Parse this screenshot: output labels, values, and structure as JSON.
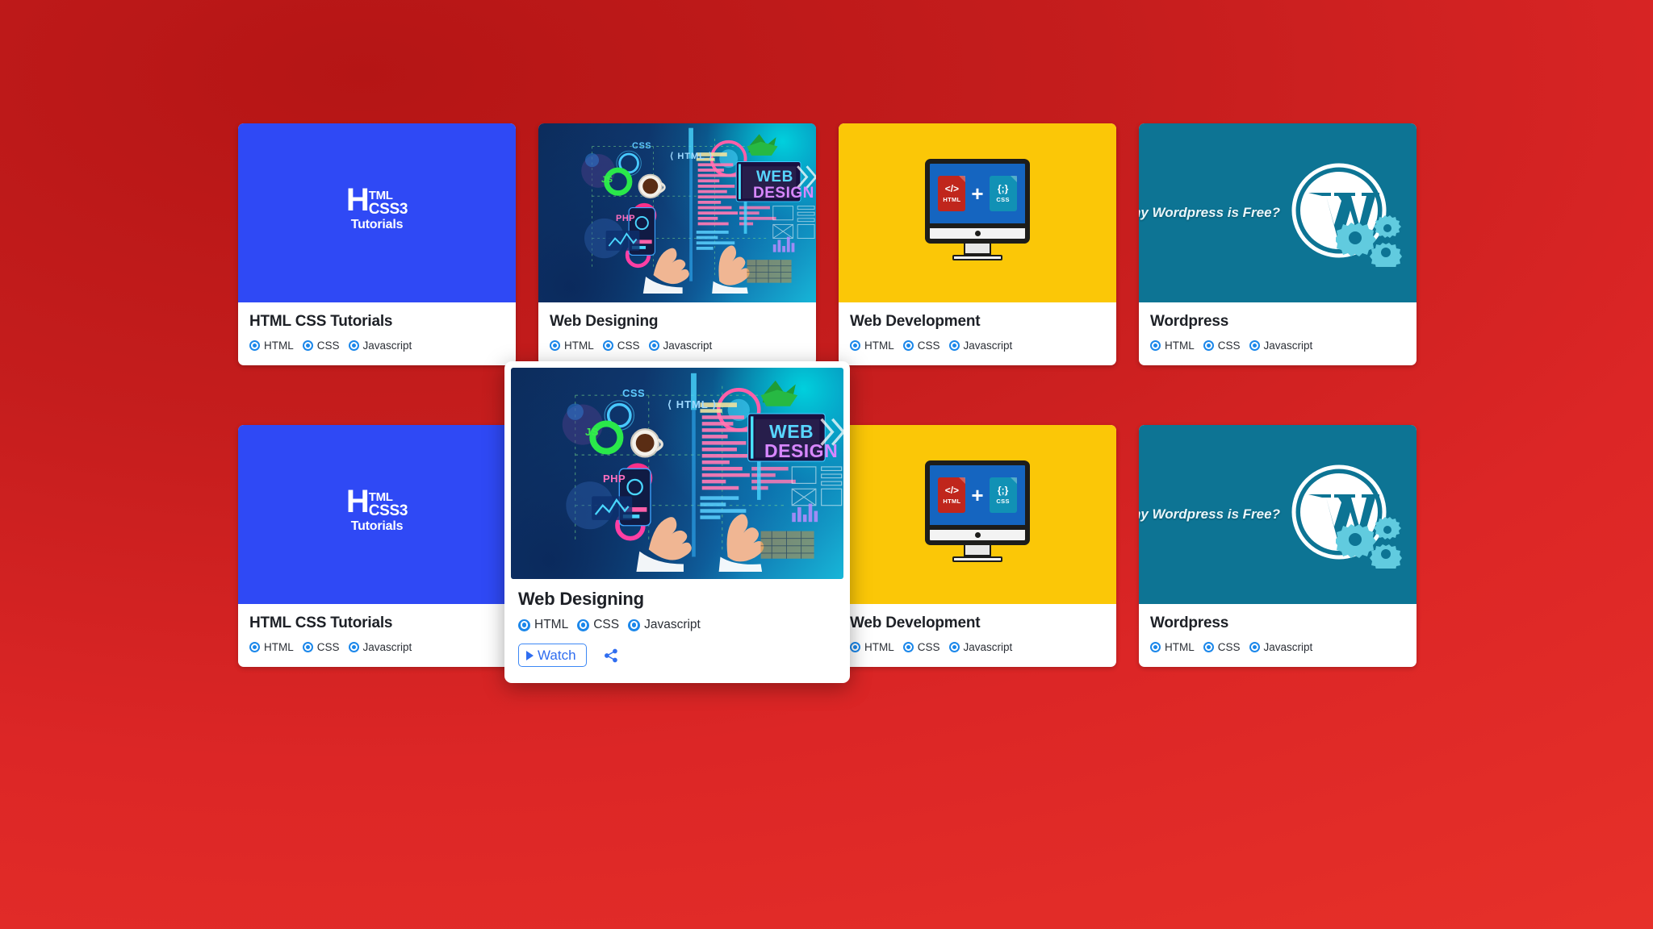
{
  "page": {
    "background_color": "#d91f1f",
    "background_accent": "#b51515"
  },
  "theme": {
    "accent_blue": "#1b87ea",
    "watch_blue": "#2f6df0",
    "card_bg": "#ffffff",
    "title_color": "#1d2026"
  },
  "tags": {
    "html": "HTML",
    "css": "CSS",
    "javascript": "Javascript"
  },
  "thumbs": {
    "htmlcss_logo": {
      "h": "H",
      "tml": "TML",
      "css3": "CSS3",
      "tutorials": "Tutorials"
    },
    "webdesign_labels": {
      "css": "CSS",
      "js": "JS",
      "php": "PHP",
      "html": "HTML",
      "web": "WEB",
      "design": "DESIGN"
    },
    "webdev_monitor": {
      "html_code": "</>",
      "html_label": "HTML",
      "css_code": "{;}",
      "css_label": "CSS",
      "plus": "+"
    },
    "wordpress_caption": "hy Wordpress is Free?",
    "wordpress_mark": "W"
  },
  "rows": [
    {
      "cards": [
        {
          "title": "HTML CSS Tutorials",
          "art": "htmlcss"
        },
        {
          "title": "Web Designing",
          "art": "webdesign"
        },
        {
          "title": "Web Development",
          "art": "webdev"
        },
        {
          "title": "Wordpress",
          "art": "wordpress"
        }
      ]
    },
    {
      "cards": [
        {
          "title": "HTML CSS Tutorials",
          "art": "htmlcss"
        },
        {
          "title": "Web Designing",
          "art": "webdesign"
        },
        {
          "title": "Web Development",
          "art": "webdev"
        },
        {
          "title": "Wordpress",
          "art": "wordpress"
        }
      ]
    }
  ],
  "hover_card": {
    "title": "Web Designing",
    "watch_label": "Watch",
    "share_label": "Share"
  }
}
